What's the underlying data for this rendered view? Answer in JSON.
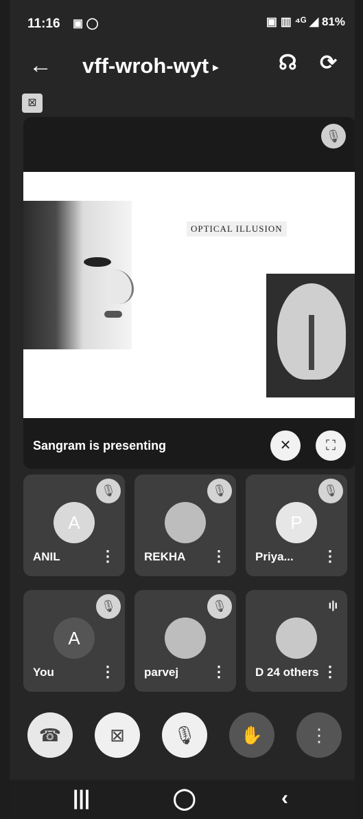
{
  "status_bar": {
    "time": "11:16",
    "left_icons": "▣ ◯",
    "battery": "81%",
    "right_icons": "▣ ▥ ⁴ᴳ ◢"
  },
  "header": {
    "back_glyph": "←",
    "meeting_code": "vff-wroh-wyt",
    "arrow_glyph": "▸",
    "audio_glyph": "☊",
    "camera_glyph": "⟳"
  },
  "screen_toggle_glyph": "⊠",
  "presentation": {
    "slide_title": "OPTICAL ILLUSION",
    "presenter_text": "Sangram is presenting",
    "pin_glyph": "✕",
    "fullscreen_glyph": "⛶",
    "mute_glyph": "🎙"
  },
  "participants": [
    {
      "name": "ANIL",
      "initial": "A",
      "avatar_color": "#d9d9d9",
      "initial_color": "#ffffff",
      "muted": true
    },
    {
      "name": "REKHA",
      "initial": "",
      "avatar_color": "#bdbdbd",
      "initial_color": "#ffffff",
      "muted": true
    },
    {
      "name": "Priya...",
      "initial": "P",
      "avatar_color": "#e6e6e6",
      "initial_color": "#ffffff",
      "muted": true
    },
    {
      "name": "You",
      "initial": "A",
      "avatar_color": "#555555",
      "initial_color": "#ffffff",
      "muted": true
    },
    {
      "name": "parvej",
      "initial": "",
      "avatar_color": "#bdbdbd",
      "initial_color": "#ffffff",
      "muted": true
    },
    {
      "name": "D 24 others",
      "initial": "",
      "avatar_color": "#c8c8c8",
      "initial_color": "#ffffff",
      "muted": false,
      "wave_glyph": "ı|ı"
    }
  ],
  "more_glyph": "⋮",
  "controls": {
    "end_call_glyph": "☎",
    "camera_off_glyph": "⊠",
    "mic_off_glyph": "🎙",
    "raise_hand_glyph": "✋",
    "more_options_glyph": "⋮",
    "end_call_color": "#e8e8e8",
    "button_color": "#f0f0f0"
  },
  "nav_bar": {
    "recents": "|||",
    "home": "◯",
    "back": "‹"
  }
}
